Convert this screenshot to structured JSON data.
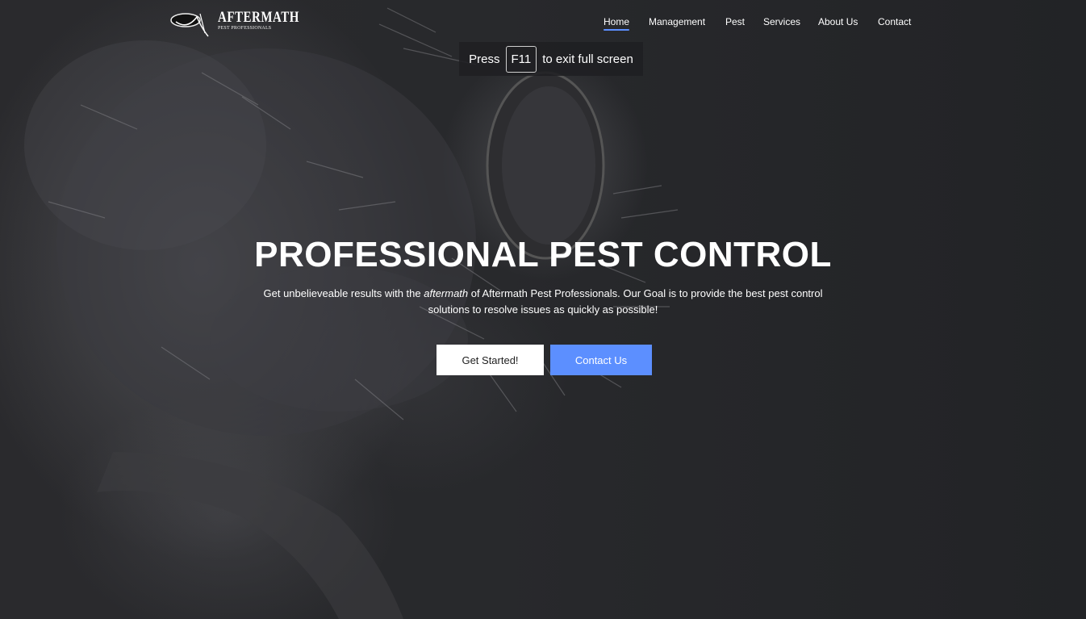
{
  "brand": {
    "name": "AFTERMATH",
    "tagline": "PEST PROFESSIONALS"
  },
  "nav": {
    "items": [
      {
        "label": "Home",
        "active": true
      },
      {
        "label": "Management"
      },
      {
        "label": "Pest"
      },
      {
        "label": "Services"
      },
      {
        "label": "About Us"
      },
      {
        "label": "Contact"
      }
    ]
  },
  "fullscreen_notice": {
    "prefix": "Press",
    "key": "F11",
    "suffix": "to exit full screen"
  },
  "hero": {
    "title": "PROFESSIONAL PEST CONTROL",
    "desc_before": "Get unbelieveable results with the ",
    "desc_em": "aftermath",
    "desc_after": " of Aftermath Pest Professionals. Our Goal is to provide the best pest control solutions to resolve issues as quickly as possible!",
    "primary_button": "Get Started!",
    "secondary_button": "Contact Us"
  },
  "colors": {
    "accent": "#5c8fff",
    "background": "#232427"
  }
}
